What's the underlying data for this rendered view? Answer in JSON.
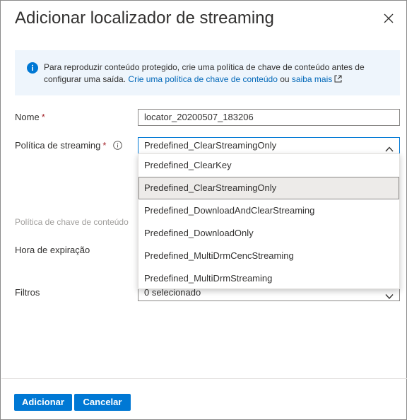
{
  "dialog": {
    "title": "Adicionar localizador de streaming",
    "close_icon": "close-icon"
  },
  "info": {
    "icon": "info-icon",
    "text_before": "Para reproduzir conteúdo protegido, crie uma política de chave de conteúdo antes de configurar uma saída. ",
    "link_create": "Crie uma política de chave de conteúdo",
    "text_or": " ou ",
    "link_learn": "saiba mais",
    "external_icon": "external-link-icon"
  },
  "form": {
    "name_label": "Nome",
    "name_value": "locator_20200507_183206",
    "policy_label": "Política de streaming",
    "policy_help_icon": "info-circle-icon",
    "policy_value": "Predefined_ClearStreamingOnly",
    "content_key_label": "Política de chave de conteúdo",
    "expiration_label": "Hora de expiração",
    "filters_label": "Filtros",
    "filters_value": "0 selecionado",
    "required_mark": "*"
  },
  "dropdown": {
    "options": [
      "Predefined_ClearKey",
      "Predefined_ClearStreamingOnly",
      "Predefined_DownloadAndClearStreaming",
      "Predefined_DownloadOnly",
      "Predefined_MultiDrmCencStreaming",
      "Predefined_MultiDrmStreaming"
    ],
    "selected_index": 1
  },
  "footer": {
    "add_label": "Adicionar",
    "cancel_label": "Cancelar"
  },
  "colors": {
    "accent": "#0078d4",
    "link": "#0067b8",
    "info_bg": "#eef5fc",
    "required": "#a4262c"
  }
}
